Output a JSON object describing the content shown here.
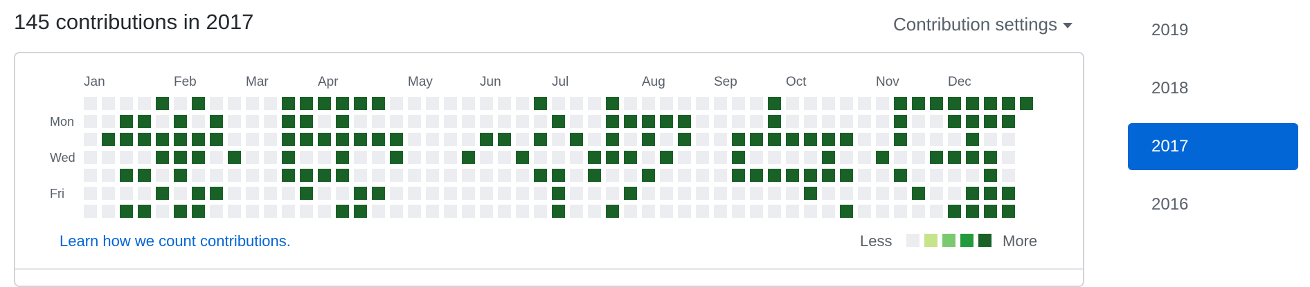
{
  "header": {
    "title": "145 contributions in 2017",
    "settings_label": "Contribution settings"
  },
  "graph": {
    "months": [
      "Jan",
      "Feb",
      "Mar",
      "Apr",
      "May",
      "Jun",
      "Jul",
      "Aug",
      "Sep",
      "Oct",
      "Nov",
      "Dec"
    ],
    "day_labels": [
      "Mon",
      "Wed",
      "Fri"
    ],
    "weeks": 53,
    "contribution_grid": [
      "....X.X....XXXXXX........X...X........X......XXXXXXXX....",
      "..XX.X.X...XX.X...........X..XXXXX....X......X..XXXX.X...",
      ".XXXXXXX...XXXXXXX....XX.X.X.X.X.X..XXXXXXX..X...X...X..",
      "....XXX.X..X..X..X...X..X...XXX.X...X....X..X..XXXX..X..",
      "..XX.X.....XXXX..........XX.X..X....XXXXXXX..X....X...X..",
      "....X.XX....X..XX.........X...X.........X.....X..XXXXXX..",
      "..XX.XX.......XX..........X..X............X.....XXXXXXXX.."
    ],
    "colors": {
      "empty": "#ebedf0",
      "level4": "#196127"
    }
  },
  "footer": {
    "learn_link": "Learn how we count contributions.",
    "legend_less": "Less",
    "legend_more": "More",
    "legend_colors": [
      "#ebedf0",
      "#c6e48b",
      "#7bc96f",
      "#239a3b",
      "#196127"
    ]
  },
  "years": {
    "items": [
      "2019",
      "2018",
      "2017",
      "2016"
    ],
    "active": "2017"
  }
}
